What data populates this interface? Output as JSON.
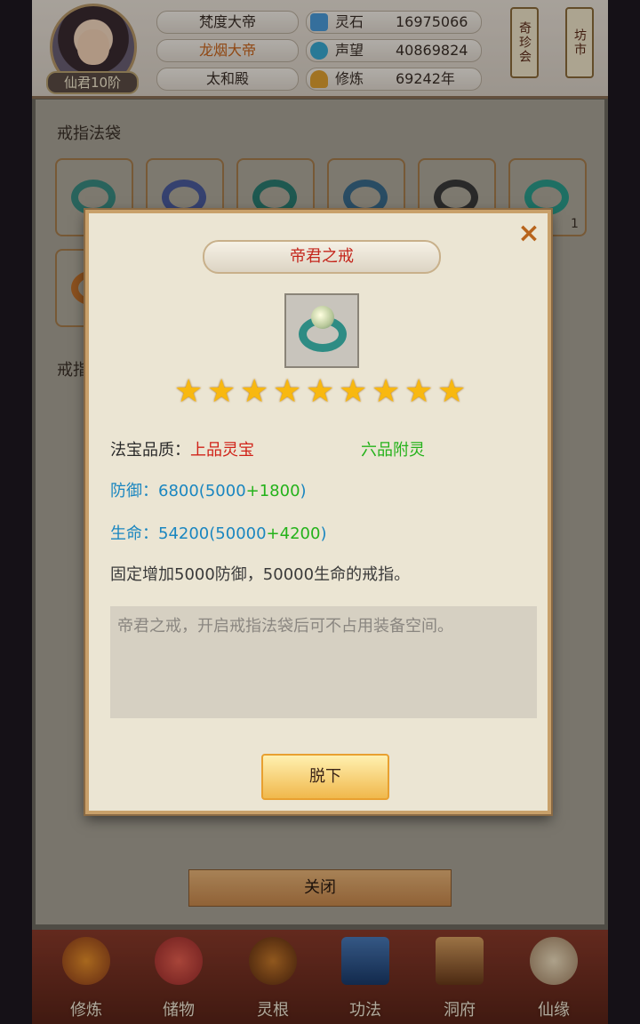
{
  "header": {
    "rank": "仙君10阶",
    "titles": [
      "梵度大帝",
      "龙烟大帝",
      "太和殿"
    ],
    "stats": [
      {
        "label": "灵石",
        "value": "16975066",
        "icon": "spirit-stone-icon"
      },
      {
        "label": "声望",
        "value": "40869824",
        "icon": "reputation-icon"
      },
      {
        "label": "修炼",
        "value": "69242年",
        "icon": "cultivation-icon"
      }
    ],
    "shortcuts": [
      "奇珍会",
      "坊市"
    ]
  },
  "inventory": {
    "section1": "戒指法袋",
    "section2": "戒指",
    "slot_count": "1",
    "close": "关闭"
  },
  "dialog": {
    "title": "帝君之戒",
    "stars": 9,
    "quality_label": "法宝品质：",
    "quality_value": "上品灵宝",
    "enchant": "六品附灵",
    "defense_label": "防御：",
    "defense_value": "6800(5000",
    "defense_bonus": "+1800",
    "defense_end": ")",
    "life_label": "生命：",
    "life_value": "54200(50000",
    "life_bonus": "+4200",
    "life_end": ")",
    "effect": "固定增加5000防御，50000生命的戒指。",
    "description": "帝君之戒，开启戒指法袋后可不占用装备空间。",
    "remove": "脱下"
  },
  "nav": [
    "修炼",
    "储物",
    "灵根",
    "功法",
    "洞府",
    "仙缘"
  ],
  "colors": {
    "quality": "#d02218",
    "enchant": "#24b21a",
    "stat": "#1a86c0",
    "star": "#f8b810"
  }
}
